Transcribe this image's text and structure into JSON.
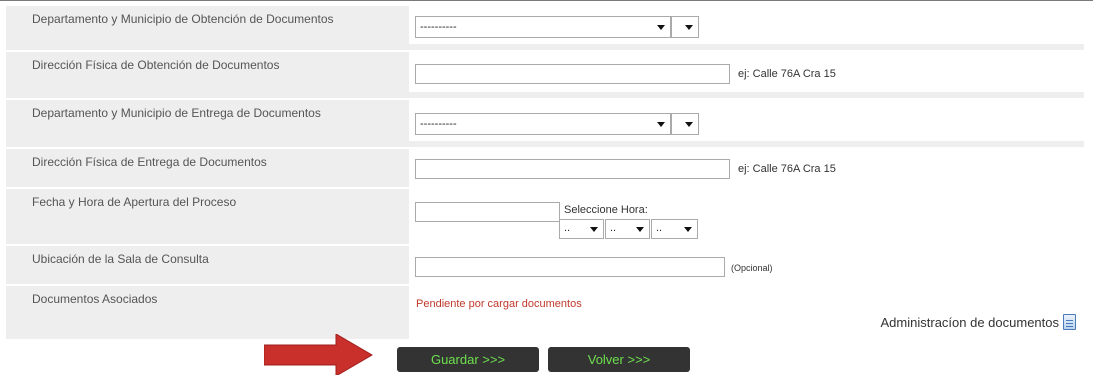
{
  "form": {
    "rows": {
      "dept_obtencion": {
        "label": "Departamento y Municipio de Obtención de Documentos",
        "select_value": "----------",
        "select2_value": ""
      },
      "dir_obtencion": {
        "label": "Dirección Física de Obtención de Documentos",
        "input_value": "",
        "hint": "ej: Calle 76A Cra 15"
      },
      "dept_entrega": {
        "label": "Departamento y Municipio de Entrega de Documentos",
        "select_value": "----------",
        "select2_value": ""
      },
      "dir_entrega": {
        "label": "Dirección Física de Entrega de Documentos",
        "input_value": "",
        "hint": "ej: Calle 76A Cra 15"
      },
      "fecha_apertura": {
        "label": "Fecha y Hora de Apertura del Proceso",
        "date_value": "",
        "hour_label": "Seleccione Hora:",
        "hour_value": "..",
        "minute_value": "..",
        "ampm_value": ".."
      },
      "sala_consulta": {
        "label": "Ubicación de la Sala de Consulta",
        "input_value": "",
        "hint": "(Opcional)"
      },
      "documentos": {
        "label": "Documentos Asociados",
        "status": "Pendiente por cargar documentos",
        "admin_link": "Administracíon de documentos"
      }
    }
  },
  "actions": {
    "save_label": "Guardar >>>",
    "back_label": "Volver >>>"
  },
  "icons": {
    "document": "document-icon",
    "arrow": "red-arrow"
  },
  "colors": {
    "label_bg": "#eeeeee",
    "button_bg": "#333333",
    "button_text": "#6ee04e",
    "pending_text": "#c0392b",
    "arrow": "#c9302c"
  }
}
